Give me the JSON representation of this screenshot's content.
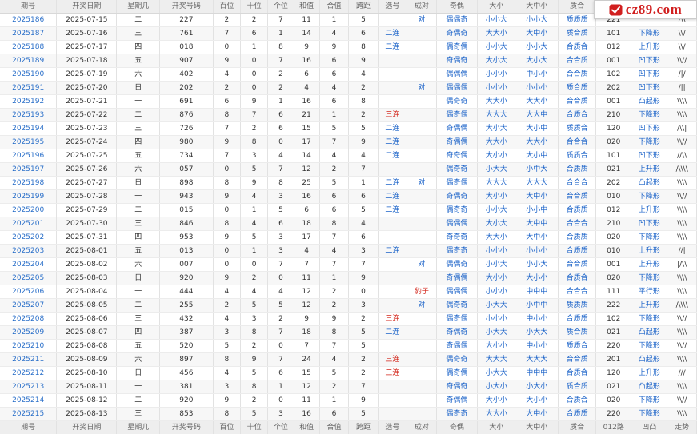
{
  "header": [
    "期号",
    "开奖日期",
    "星期几",
    "开奖号码",
    "百位",
    "十位",
    "个位",
    "和值",
    "合值",
    "跨距",
    "选号",
    "成对",
    "奇偶",
    "大小",
    "大中小",
    "质合",
    "012路",
    "凹凸",
    "走势"
  ],
  "rows": [
    [
      "2025186",
      "2025-07-15",
      "二",
      "227",
      "2",
      "2",
      "7",
      "11",
      "1",
      "5",
      "",
      "对",
      "偶偶奇",
      "小小大",
      "小小大",
      "质质质",
      "221",
      "",
      "/\\\\"
    ],
    [
      "2025187",
      "2025-07-16",
      "三",
      "761",
      "7",
      "6",
      "1",
      "14",
      "4",
      "6",
      "二连",
      "",
      "奇偶奇",
      "大大小",
      "大中小",
      "质合质",
      "101",
      "下降形",
      "\\\\/"
    ],
    [
      "2025188",
      "2025-07-17",
      "四",
      "018",
      "0",
      "1",
      "8",
      "9",
      "9",
      "8",
      "二连",
      "",
      "偶奇偶",
      "小小大",
      "小小大",
      "合质合",
      "012",
      "上升形",
      "\\\\/"
    ],
    [
      "2025189",
      "2025-07-18",
      "五",
      "907",
      "9",
      "0",
      "7",
      "16",
      "6",
      "9",
      "",
      "",
      "奇偶奇",
      "大小大",
      "大小大",
      "合合质",
      "001",
      "凹下形",
      "\\\\//"
    ],
    [
      "2025190",
      "2025-07-19",
      "六",
      "402",
      "4",
      "0",
      "2",
      "6",
      "6",
      "4",
      "",
      "",
      "偶偶偶",
      "小小小",
      "中小小",
      "合合质",
      "102",
      "凹下形",
      "/|/"
    ],
    [
      "2025191",
      "2025-07-20",
      "日",
      "202",
      "2",
      "0",
      "2",
      "4",
      "4",
      "2",
      "",
      "对",
      "偶偶偶",
      "小小小",
      "小小小",
      "质合质",
      "202",
      "凹下形",
      "/||"
    ],
    [
      "2025192",
      "2025-07-21",
      "一",
      "691",
      "6",
      "9",
      "1",
      "16",
      "6",
      "8",
      "",
      "",
      "偶奇奇",
      "大大小",
      "大大小",
      "合合质",
      "001",
      "凸起形",
      "\\\\\\\\"
    ],
    [
      "2025193",
      "2025-07-22",
      "二",
      "876",
      "8",
      "7",
      "6",
      "21",
      "1",
      "2",
      "三连",
      "",
      "偶奇偶",
      "大大大",
      "大大中",
      "合质合",
      "210",
      "下降形",
      "\\\\\\\\"
    ],
    [
      "2025194",
      "2025-07-23",
      "三",
      "726",
      "7",
      "2",
      "6",
      "15",
      "5",
      "5",
      "二连",
      "",
      "奇偶偶",
      "大小大",
      "大小中",
      "质质合",
      "120",
      "凹下形",
      "/\\\\|"
    ],
    [
      "2025195",
      "2025-07-24",
      "四",
      "980",
      "9",
      "8",
      "0",
      "17",
      "7",
      "9",
      "二连",
      "",
      "奇偶偶",
      "大大小",
      "大大小",
      "合合合",
      "020",
      "下降形",
      "\\\\//"
    ],
    [
      "2025196",
      "2025-07-25",
      "五",
      "734",
      "7",
      "3",
      "4",
      "14",
      "4",
      "4",
      "二连",
      "",
      "奇奇偶",
      "大小小",
      "大小中",
      "质质合",
      "101",
      "凹下形",
      "//\\\\"
    ],
    [
      "2025197",
      "2025-07-26",
      "六",
      "057",
      "0",
      "5",
      "7",
      "12",
      "2",
      "7",
      "",
      "",
      "偶奇奇",
      "小大大",
      "小中大",
      "合质质",
      "021",
      "上升形",
      "/\\\\\\\\"
    ],
    [
      "2025198",
      "2025-07-27",
      "日",
      "898",
      "8",
      "9",
      "8",
      "25",
      "5",
      "1",
      "二连",
      "对",
      "偶奇偶",
      "大大大",
      "大大大",
      "合合合",
      "202",
      "凸起形",
      "\\\\\\\\"
    ],
    [
      "2025199",
      "2025-07-28",
      "一",
      "943",
      "9",
      "4",
      "3",
      "16",
      "6",
      "6",
      "二连",
      "",
      "奇偶奇",
      "大小小",
      "大中小",
      "合合质",
      "010",
      "下降形",
      "\\\\//"
    ],
    [
      "2025200",
      "2025-07-29",
      "二",
      "015",
      "0",
      "1",
      "5",
      "6",
      "6",
      "5",
      "二连",
      "",
      "偶奇奇",
      "小小大",
      "小小中",
      "合质质",
      "012",
      "上升形",
      "\\\\\\\\"
    ],
    [
      "2025201",
      "2025-07-30",
      "三",
      "846",
      "8",
      "4",
      "6",
      "18",
      "8",
      "4",
      "",
      "",
      "偶偶偶",
      "大小大",
      "大中中",
      "合合合",
      "210",
      "凹下形",
      "\\\\\\\\"
    ],
    [
      "2025202",
      "2025-07-31",
      "四",
      "953",
      "9",
      "5",
      "3",
      "17",
      "7",
      "6",
      "",
      "",
      "奇奇奇",
      "大大小",
      "大中小",
      "合质质",
      "020",
      "下降形",
      "\\\\\\\\"
    ],
    [
      "2025203",
      "2025-08-01",
      "五",
      "013",
      "0",
      "1",
      "3",
      "4",
      "4",
      "3",
      "二连",
      "",
      "偶奇奇",
      "小小小",
      "小小小",
      "合质质",
      "010",
      "上升形",
      "//|"
    ],
    [
      "2025204",
      "2025-08-02",
      "六",
      "007",
      "0",
      "0",
      "7",
      "7",
      "7",
      "7",
      "",
      "对",
      "偶偶奇",
      "小小大",
      "小小大",
      "合合质",
      "001",
      "上升形",
      "|/\\\\"
    ],
    [
      "2025205",
      "2025-08-03",
      "日",
      "920",
      "9",
      "2",
      "0",
      "11",
      "1",
      "9",
      "",
      "",
      "奇偶偶",
      "大小小",
      "大小小",
      "合质合",
      "020",
      "下降形",
      "\\\\\\\\"
    ],
    [
      "2025206",
      "2025-08-04",
      "一",
      "444",
      "4",
      "4",
      "4",
      "12",
      "2",
      "0",
      "",
      "豹子",
      "偶偶偶",
      "小小小",
      "中中中",
      "合合合",
      "111",
      "平行形",
      "\\\\\\\\"
    ],
    [
      "2025207",
      "2025-08-05",
      "二",
      "255",
      "2",
      "5",
      "5",
      "12",
      "2",
      "3",
      "",
      "对",
      "偶奇奇",
      "小大大",
      "小中中",
      "质质质",
      "222",
      "上升形",
      "/\\\\\\\\"
    ],
    [
      "2025208",
      "2025-08-06",
      "三",
      "432",
      "4",
      "3",
      "2",
      "9",
      "9",
      "2",
      "三连",
      "",
      "偶奇偶",
      "小小小",
      "中小小",
      "合质质",
      "102",
      "下降形",
      "\\\\//"
    ],
    [
      "2025209",
      "2025-08-07",
      "四",
      "387",
      "3",
      "8",
      "7",
      "18",
      "8",
      "5",
      "二连",
      "",
      "奇偶奇",
      "小大大",
      "小大大",
      "质合质",
      "021",
      "凸起形",
      "\\\\\\\\"
    ],
    [
      "2025210",
      "2025-08-08",
      "五",
      "520",
      "5",
      "2",
      "0",
      "7",
      "7",
      "5",
      "",
      "",
      "奇偶偶",
      "大小小",
      "中小小",
      "质质合",
      "220",
      "下降形",
      "\\\\//"
    ],
    [
      "2025211",
      "2025-08-09",
      "六",
      "897",
      "8",
      "9",
      "7",
      "24",
      "4",
      "2",
      "三连",
      "",
      "偶奇奇",
      "大大大",
      "大大大",
      "合合质",
      "201",
      "凸起形",
      "\\\\\\\\"
    ],
    [
      "2025212",
      "2025-08-10",
      "日",
      "456",
      "4",
      "5",
      "6",
      "15",
      "5",
      "2",
      "三连",
      "",
      "偶奇偶",
      "小大大",
      "中中中",
      "合质合",
      "120",
      "上升形",
      "///"
    ],
    [
      "2025213",
      "2025-08-11",
      "一",
      "381",
      "3",
      "8",
      "1",
      "12",
      "2",
      "7",
      "",
      "",
      "奇偶奇",
      "小大小",
      "小大小",
      "质合质",
      "021",
      "凸起形",
      "\\\\\\\\"
    ],
    [
      "2025214",
      "2025-08-12",
      "二",
      "920",
      "9",
      "2",
      "0",
      "11",
      "1",
      "9",
      "",
      "",
      "奇偶偶",
      "大小小",
      "大小小",
      "合质合",
      "020",
      "下降形",
      "\\\\//"
    ],
    [
      "2025215",
      "2025-08-13",
      "三",
      "853",
      "8",
      "5",
      "3",
      "16",
      "6",
      "5",
      "",
      "",
      "偶奇奇",
      "大大小",
      "大中小",
      "合质质",
      "220",
      "下降形",
      "\\\\\\\\"
    ]
  ],
  "watermark": {
    "text": "cz89.com",
    "color": "#d11f1f",
    "logo_icon": "red-badge-icon"
  },
  "colors": {
    "link_blue": "#2a6fc9",
    "pattern_blue": "#1a62c8",
    "mark_red": "#d3261b",
    "header_bg": "#eeeeee"
  }
}
